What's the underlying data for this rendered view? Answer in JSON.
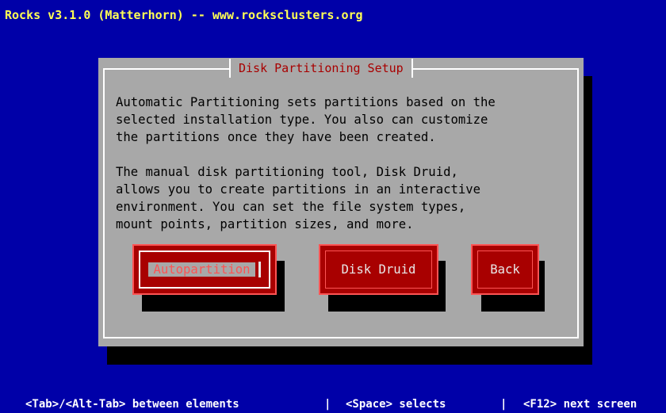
{
  "title_bar": "Rocks v3.1.0 (Matterhorn) -- www.rocksclusters.org",
  "dialog": {
    "title": "Disk Partitioning Setup",
    "text_lines": [
      "Automatic Partitioning sets partitions based on the",
      "selected installation type. You also can customize",
      "the partitions once they have been created.",
      "",
      "The manual disk partitioning tool, Disk Druid,",
      "allows you to create partitions in an interactive",
      "environment. You can set the file system types,",
      "mount points, partition sizes, and more."
    ],
    "buttons": {
      "autopartition": "Autopartition",
      "disk_druid": "Disk Druid",
      "back": "Back"
    }
  },
  "help": {
    "tab": "<Tab>/<Alt-Tab> between elements",
    "sep1": "|",
    "space": "<Space> selects",
    "sep2": "|",
    "f12": "<F12> next screen"
  },
  "colors": {
    "background": "#0000a8",
    "title_text": "#ffff54",
    "dialog_bg": "#a8a8a8",
    "dialog_title": "#a80000",
    "button_bg": "#a80000",
    "shadow": "#000000"
  }
}
